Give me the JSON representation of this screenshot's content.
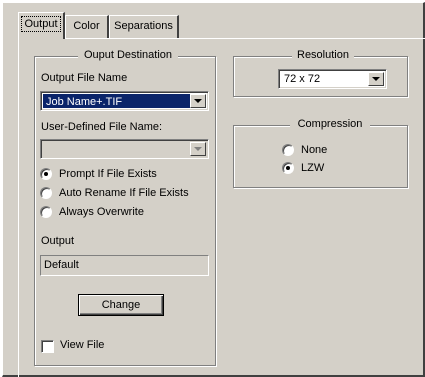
{
  "tabs": [
    {
      "label": "Output"
    },
    {
      "label": "Color"
    },
    {
      "label": "Separations"
    }
  ],
  "output_destination": {
    "title": "Ouput Destination",
    "output_file_name_label": "Output File Name",
    "output_file_name_value": "Job Name+.TIF",
    "user_defined_label": "User-Defined File Name:",
    "user_defined_value": "",
    "file_exists_options": [
      {
        "label": "Prompt If File Exists",
        "selected": true
      },
      {
        "label": "Auto Rename If File Exists",
        "selected": false
      },
      {
        "label": "Always Overwrite",
        "selected": false
      }
    ],
    "output_label": "Output",
    "output_value": "Default",
    "change_button": "Change",
    "view_file_label": "View File",
    "view_file_checked": false
  },
  "resolution": {
    "title": "Resolution",
    "value": "72 x 72"
  },
  "compression": {
    "title": "Compression",
    "options": [
      {
        "label": "None",
        "selected": false
      },
      {
        "label": "LZW",
        "selected": true
      }
    ]
  }
}
